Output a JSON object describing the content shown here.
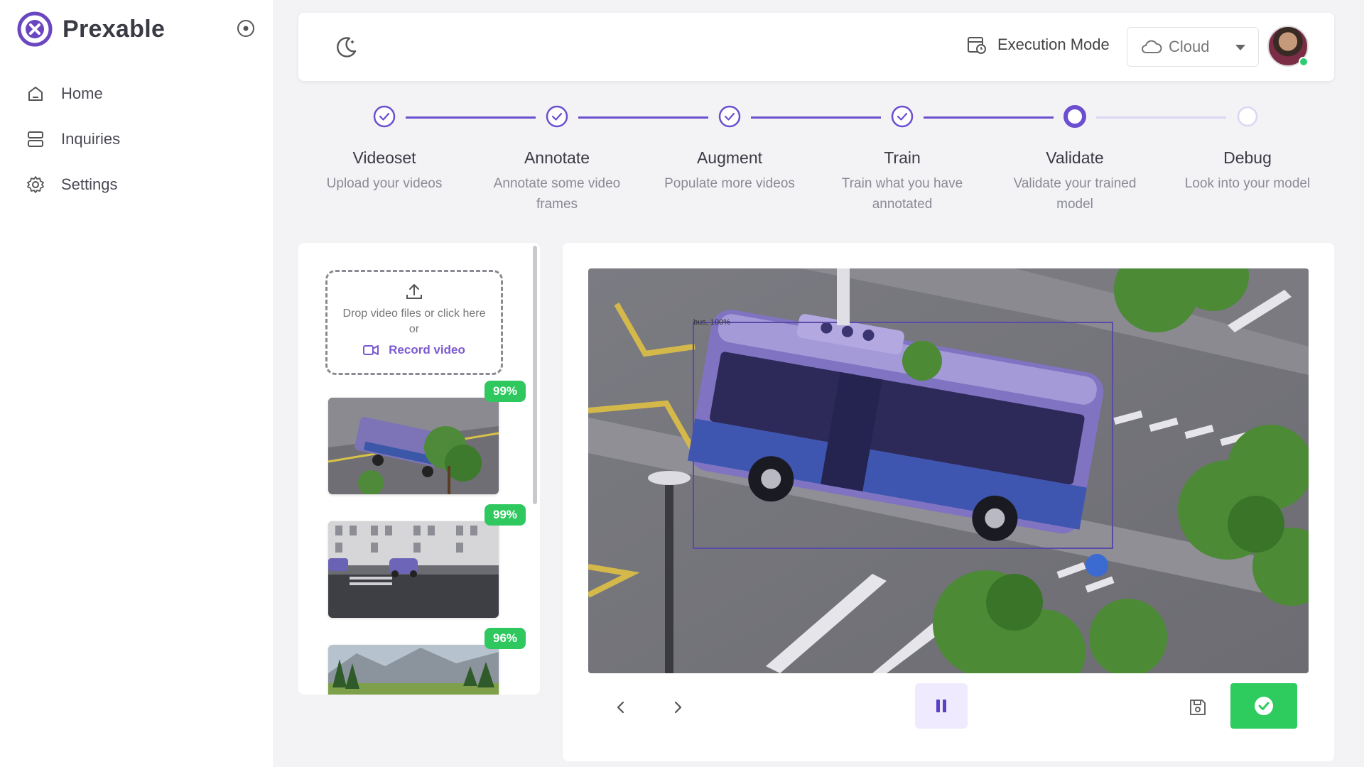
{
  "app": {
    "name": "Prexable",
    "brand_color": "#6b46c1"
  },
  "sidebar": {
    "items": [
      {
        "label": "Home",
        "icon": "home-icon"
      },
      {
        "label": "Inquiries",
        "icon": "server-icon"
      },
      {
        "label": "Settings",
        "icon": "gear-icon"
      }
    ]
  },
  "header": {
    "execution_mode_label": "Execution Mode",
    "execution_mode_value": "Cloud"
  },
  "stepper": {
    "steps": [
      {
        "title": "Videoset",
        "desc": "Upload your videos",
        "state": "done"
      },
      {
        "title": "Annotate",
        "desc": "Annotate some video frames",
        "state": "done"
      },
      {
        "title": "Augment",
        "desc": "Populate more videos",
        "state": "done"
      },
      {
        "title": "Train",
        "desc": "Train what you have annotated",
        "state": "done"
      },
      {
        "title": "Validate",
        "desc": "Validate your trained model",
        "state": "active"
      },
      {
        "title": "Debug",
        "desc": "Look into your model",
        "state": "pending"
      }
    ],
    "active_color": "#6b4fcf",
    "pending_color": "#dcd6f3"
  },
  "upload": {
    "drop_text": "Drop video files or click here or",
    "record_label": "Record video"
  },
  "videos": [
    {
      "score": "99%",
      "scene": "bus-street"
    },
    {
      "score": "99%",
      "scene": "buildings-street"
    },
    {
      "score": "96%",
      "scene": "mountain-meadow"
    }
  ],
  "detection": {
    "label": "bus, 100%"
  },
  "status_colors": {
    "success": "#2ecc5e"
  }
}
